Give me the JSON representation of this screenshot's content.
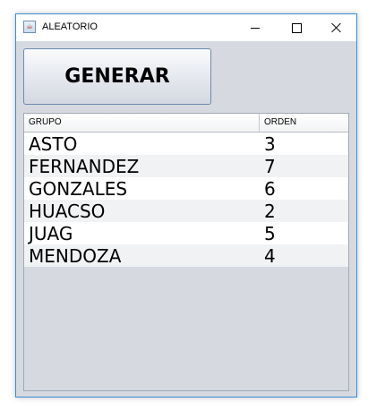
{
  "window": {
    "title": "ALEATORIO"
  },
  "generate_button": {
    "label": "GENERAR"
  },
  "table": {
    "columns": [
      "GRUPO",
      "ORDEN"
    ],
    "rows": [
      {
        "grupo": "ASTO",
        "orden": "3"
      },
      {
        "grupo": "FERNANDEZ",
        "orden": "7"
      },
      {
        "grupo": "GONZALES",
        "orden": "6"
      },
      {
        "grupo": "HUACSO",
        "orden": "2"
      },
      {
        "grupo": "JUAG",
        "orden": "5"
      },
      {
        "grupo": "MENDOZA",
        "orden": "4"
      }
    ]
  },
  "icons": {
    "app": "java-cup-icon",
    "minimize": "minimize-icon",
    "maximize": "maximize-icon",
    "close": "close-icon"
  },
  "colors": {
    "window_border": "#3c8fd6",
    "panel_background": "#d6d9e0",
    "button_border": "#6b8bb3"
  }
}
